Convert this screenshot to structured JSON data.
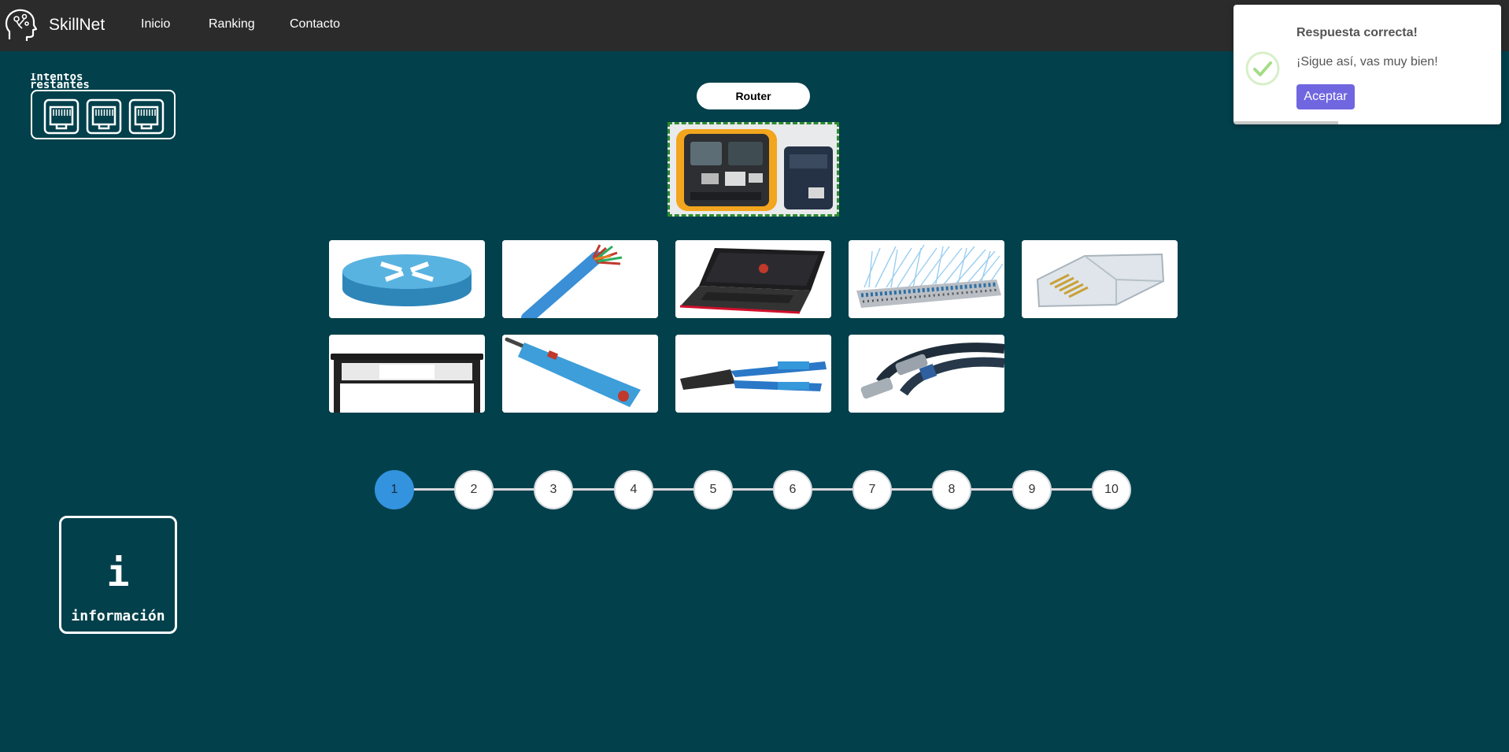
{
  "navbar": {
    "brand": "SkillNet",
    "links": [
      "Inicio",
      "Ranking",
      "Contacto"
    ]
  },
  "attempts": {
    "label": "Intentos restantes",
    "remaining": 3,
    "icon": "ethernet-port-icon"
  },
  "question": {
    "target_label": "Router",
    "image": "cable-tester-image"
  },
  "options": [
    {
      "name": "router"
    },
    {
      "name": "utp-cable"
    },
    {
      "name": "laptop"
    },
    {
      "name": "patch-panel"
    },
    {
      "name": "rj45-connector"
    },
    {
      "name": "rack"
    },
    {
      "name": "punch-down-tool"
    },
    {
      "name": "crimping-tool"
    },
    {
      "name": "coaxial-cable"
    }
  ],
  "progress": {
    "steps": [
      "1",
      "2",
      "3",
      "4",
      "5",
      "6",
      "7",
      "8",
      "9",
      "10"
    ],
    "current": 1
  },
  "info": {
    "icon_glyph": "i",
    "label": "información"
  },
  "toast": {
    "title": "Respuesta correcta!",
    "message": "¡Sigue así, vas muy bien!",
    "button": "Aceptar",
    "icon": "success-check-icon",
    "timer_fraction": 0.39
  },
  "colors": {
    "background": "#02404b",
    "navbar": "#2b2b2b",
    "active_step": "#3393df",
    "toast_button": "#7066e0",
    "success": "#a5dc86"
  }
}
